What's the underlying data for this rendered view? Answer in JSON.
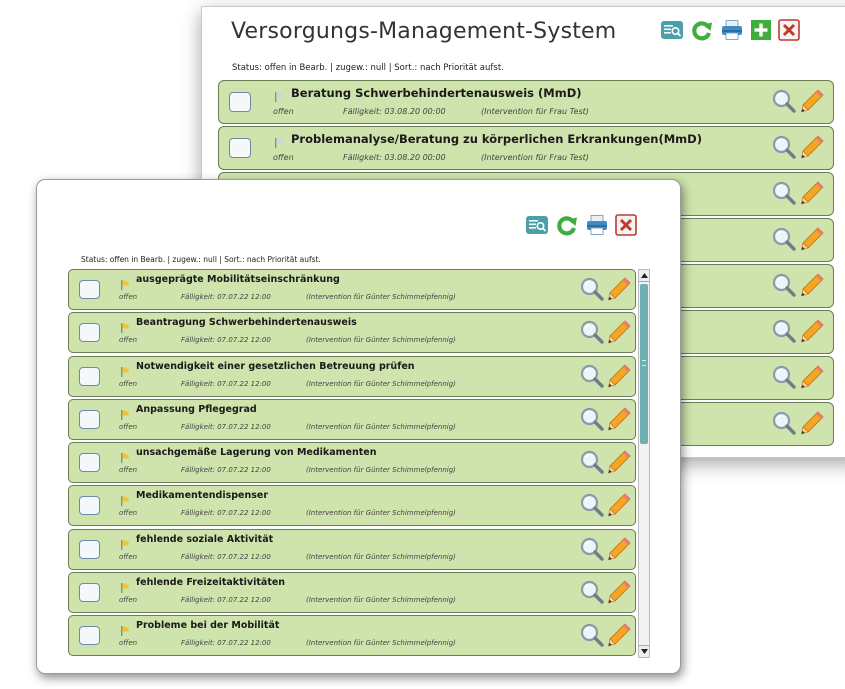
{
  "colors": {
    "row_bg": "#cfe3ad",
    "row_border": "#6b7d53",
    "accent_teal": "#4aa0a8",
    "refresh_green": "#3fae3f",
    "close_red": "#c0392b",
    "scroll_thumb": "#6fb0b3"
  },
  "back_window": {
    "title": "Versorgungs-Management-System",
    "status": "Status: offen in Bearb.  | zugew.: null | Sort.: nach Priorität aufst.",
    "toolbar": [
      "search-list-icon",
      "refresh-icon",
      "print-icon",
      "add-icon",
      "close-icon"
    ],
    "rows": [
      {
        "title": "Beratung Schwerbehindertenausweis (MmD)",
        "state": "offen",
        "due": "Fälligkeit: 03.08.20 00:00",
        "intervention": "(Intervention für Frau Test)"
      },
      {
        "title": "Problemanalyse/Beratung zu körperlichen Erkrankungen(MmD)",
        "state": "offen",
        "due": "Fälligkeit: 03.08.20 00:00",
        "intervention": "(Intervention für Frau Test)"
      },
      {
        "title": "",
        "state": "",
        "due": "",
        "intervention": ""
      },
      {
        "title": "",
        "state": "",
        "due": "",
        "intervention": ""
      },
      {
        "title": "",
        "state": "",
        "due": "",
        "intervention": ""
      },
      {
        "title": "",
        "state": "",
        "due": "",
        "intervention": ""
      },
      {
        "title": "",
        "state": "",
        "due": "",
        "intervention": ""
      },
      {
        "title": "",
        "state": "",
        "due": "",
        "intervention": ""
      }
    ]
  },
  "front_window": {
    "status": "Status: offen in Bearb.  | zugew.: null | Sort.: nach Priorität aufst.",
    "toolbar": [
      "search-list-icon",
      "refresh-icon",
      "print-icon",
      "close-icon"
    ],
    "rows": [
      {
        "title": "ausgeprägte Mobilitätseinschränkung",
        "state": "offen",
        "due": "Fälligkeit: 07.07.22 12:00",
        "intervention": "(Intervention für Günter Schimmelpfennig)"
      },
      {
        "title": "Beantragung Schwerbehindertenausweis",
        "state": "offen",
        "due": "Fälligkeit: 07.07.22 12:00",
        "intervention": "(Intervention für Günter Schimmelpfennig)"
      },
      {
        "title": "Notwendigkeit einer gesetzlichen Betreuung prüfen",
        "state": "offen",
        "due": "Fälligkeit: 07.07.22 12:00",
        "intervention": "(Intervention für Günter Schimmelpfennig)"
      },
      {
        "title": "Anpassung Pflegegrad",
        "state": "offen",
        "due": "Fälligkeit: 07.07.22 12:00",
        "intervention": "(Intervention für Günter Schimmelpfennig)"
      },
      {
        "title": "unsachgemäße Lagerung von Medikamenten",
        "state": "offen",
        "due": "Fälligkeit: 07.07.22 12:00",
        "intervention": "(Intervention für Günter Schimmelpfennig)"
      },
      {
        "title": "Medikamentendispenser",
        "state": "offen",
        "due": "Fälligkeit: 07.07.22 12:00",
        "intervention": "(Intervention für Günter Schimmelpfennig)"
      },
      {
        "title": "fehlende soziale Aktivität",
        "state": "offen",
        "due": "Fälligkeit: 07.07.22 12:00",
        "intervention": "(Intervention für Günter Schimmelpfennig)"
      },
      {
        "title": "fehlende Freizeitaktivitäten",
        "state": "offen",
        "due": "Fälligkeit: 07.07.22 12:00",
        "intervention": "(Intervention für Günter Schimmelpfennig)"
      },
      {
        "title": "Probleme bei der Mobilität",
        "state": "offen",
        "due": "Fälligkeit: 07.07.22 12:00",
        "intervention": "(Intervention für Günter Schimmelpfennig)"
      }
    ]
  }
}
